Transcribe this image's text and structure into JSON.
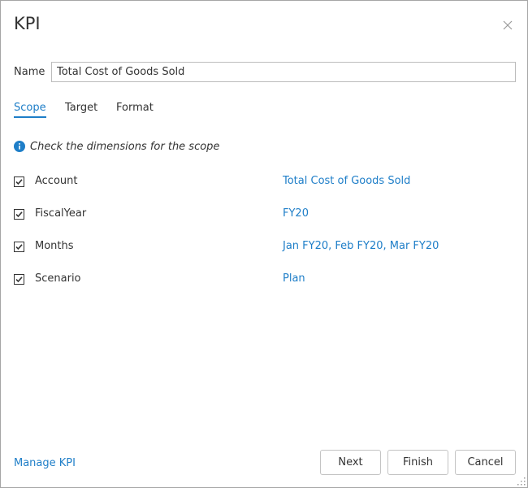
{
  "dialog": {
    "title": "KPI",
    "close_icon": "close-icon"
  },
  "name_field": {
    "label": "Name",
    "value": "Total Cost of Goods Sold"
  },
  "tabs": [
    {
      "label": "Scope",
      "active": true
    },
    {
      "label": "Target",
      "active": false
    },
    {
      "label": "Format",
      "active": false
    }
  ],
  "hint": {
    "icon": "info-icon",
    "text": "Check the dimensions for the scope"
  },
  "dimensions": [
    {
      "label": "Account",
      "value": "Total Cost of Goods Sold",
      "checked": true
    },
    {
      "label": "FiscalYear",
      "value": "FY20",
      "checked": true
    },
    {
      "label": "Months",
      "value": "Jan FY20, Feb FY20, Mar FY20",
      "checked": true
    },
    {
      "label": "Scenario",
      "value": "Plan",
      "checked": true
    }
  ],
  "footer": {
    "manage_link": "Manage KPI",
    "next_label": "Next",
    "finish_label": "Finish",
    "cancel_label": "Cancel"
  },
  "colors": {
    "accent": "#1e7ec8",
    "text": "#333333",
    "border": "#bcbcbc"
  }
}
